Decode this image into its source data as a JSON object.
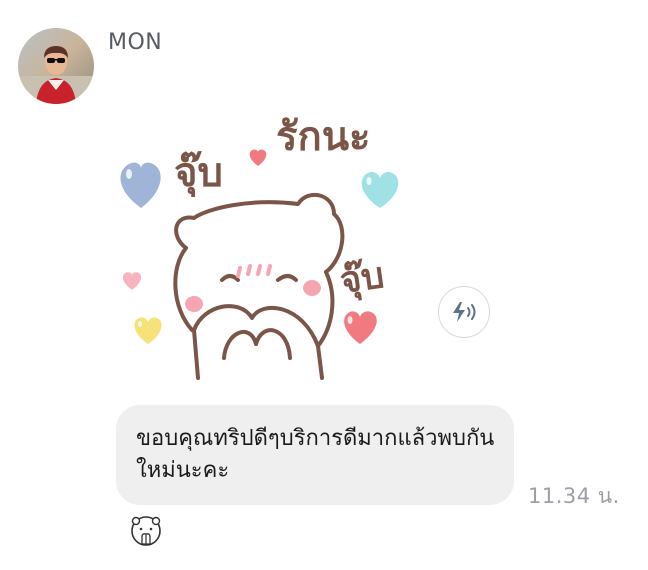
{
  "sender": {
    "name": "MON",
    "avatar_icon": "profile-photo"
  },
  "sticker": {
    "icon": "bear-love-sticker",
    "texts": [
      "จุ๊บ",
      "รักนะ",
      "จุ๊บ"
    ]
  },
  "sound_button": {
    "icon": "lightning-sound-icon"
  },
  "message": {
    "text": "ขอบคุณทริปดีๆบริการดีมากแล้วพบกัน ใหม่นะคะ",
    "timestamp": "11.34 น."
  },
  "reaction": {
    "icon": "bear-reaction-icon"
  },
  "colors": {
    "bubble": "#efefef",
    "name": "#555c66",
    "timestamp": "#9aa0a6",
    "sticker_stroke": "#7a5548"
  }
}
